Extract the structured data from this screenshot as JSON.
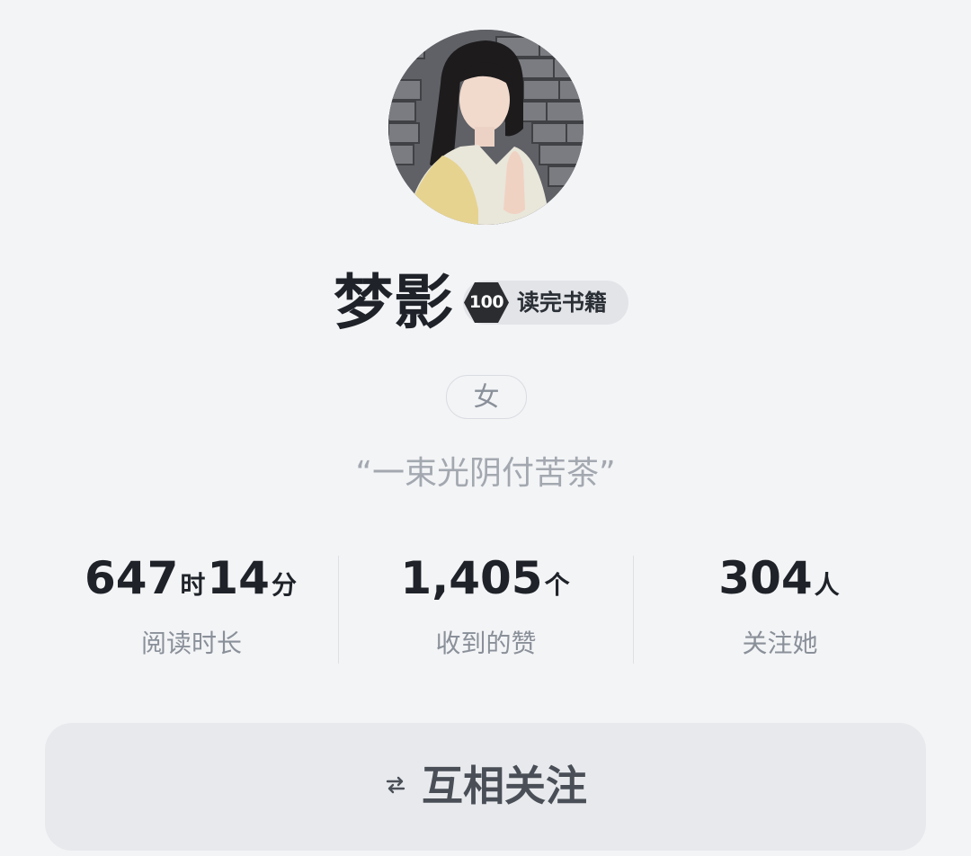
{
  "profile": {
    "name": "梦影",
    "badge": {
      "count": "100",
      "label": "读完书籍"
    },
    "gender": "女",
    "signature": "“一束光阴付苦茶”"
  },
  "stats": {
    "reading_time": {
      "hours": "647",
      "hours_unit": "时",
      "minutes": "14",
      "minutes_unit": "分",
      "label": "阅读时长"
    },
    "likes": {
      "value": "1,405",
      "unit": "个",
      "label": "收到的赞"
    },
    "followers": {
      "value": "304",
      "unit": "人",
      "label": "关注她"
    }
  },
  "actions": {
    "follow_label": "互相关注",
    "follow_icon": "swap-arrows-icon"
  },
  "colors": {
    "background": "#f3f4f6",
    "text_primary": "#1f2329",
    "text_secondary": "#8a9099",
    "badge_bg": "#e2e4e8",
    "badge_hex": "#2a2c30",
    "button_bg": "#e7e9ec"
  }
}
